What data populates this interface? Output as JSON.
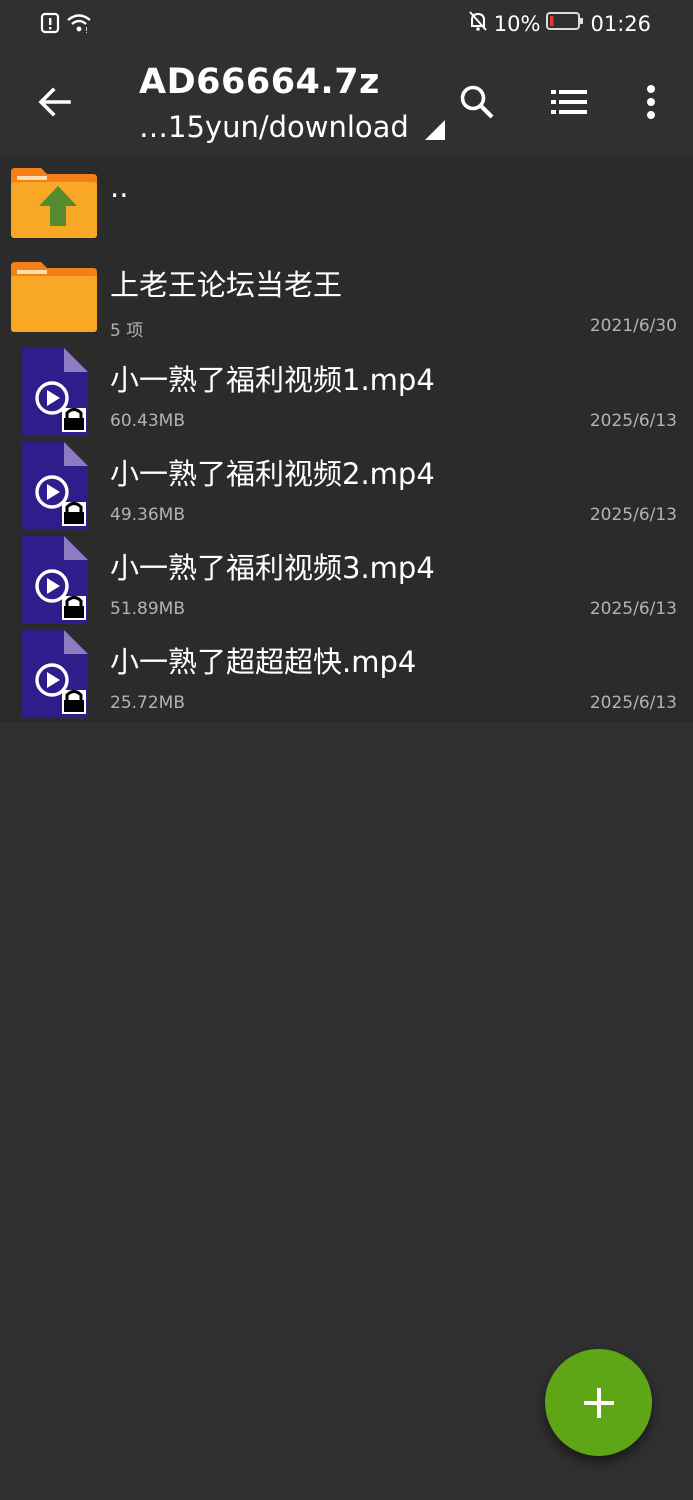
{
  "status_bar": {
    "battery_percent": "10%",
    "time": "01:26",
    "icons": [
      "alert-icon",
      "wifi-icon",
      "mute-bell-icon",
      "battery-icon"
    ]
  },
  "toolbar": {
    "title": "AD66664.7z",
    "path": "…15yun/download",
    "icons": [
      "back-arrow-icon",
      "search-icon",
      "list-view-icon",
      "more-icon"
    ]
  },
  "files": [
    {
      "name": "..",
      "meta": "",
      "date": "",
      "icon": "parent-folder-icon"
    },
    {
      "name": "上老王论坛当老王",
      "meta": "5 项",
      "date": "2021/6/30",
      "icon": "folder-icon"
    },
    {
      "name": "小一熟了福利视频1.mp4",
      "meta": "60.43MB",
      "date": "2025/6/13",
      "icon": "encrypted-video-icon"
    },
    {
      "name": "小一熟了福利视频2.mp4",
      "meta": "49.36MB",
      "date": "2025/6/13",
      "icon": "encrypted-video-icon"
    },
    {
      "name": "小一熟了福利视频3.mp4",
      "meta": "51.89MB",
      "date": "2025/6/13",
      "icon": "encrypted-video-icon"
    },
    {
      "name": "小一熟了超超超快.mp4",
      "meta": "25.72MB",
      "date": "2025/6/13",
      "icon": "encrypted-video-icon"
    }
  ],
  "fab": {
    "icon": "plus-icon"
  },
  "colors": {
    "background": "#303030",
    "list_background": "#2b2b2b",
    "folder": "#f9a825",
    "arrow_green": "#558b2f",
    "video_icon": "#2e1d8a",
    "fab": "#5fa617",
    "battery_low": "#e53935"
  }
}
